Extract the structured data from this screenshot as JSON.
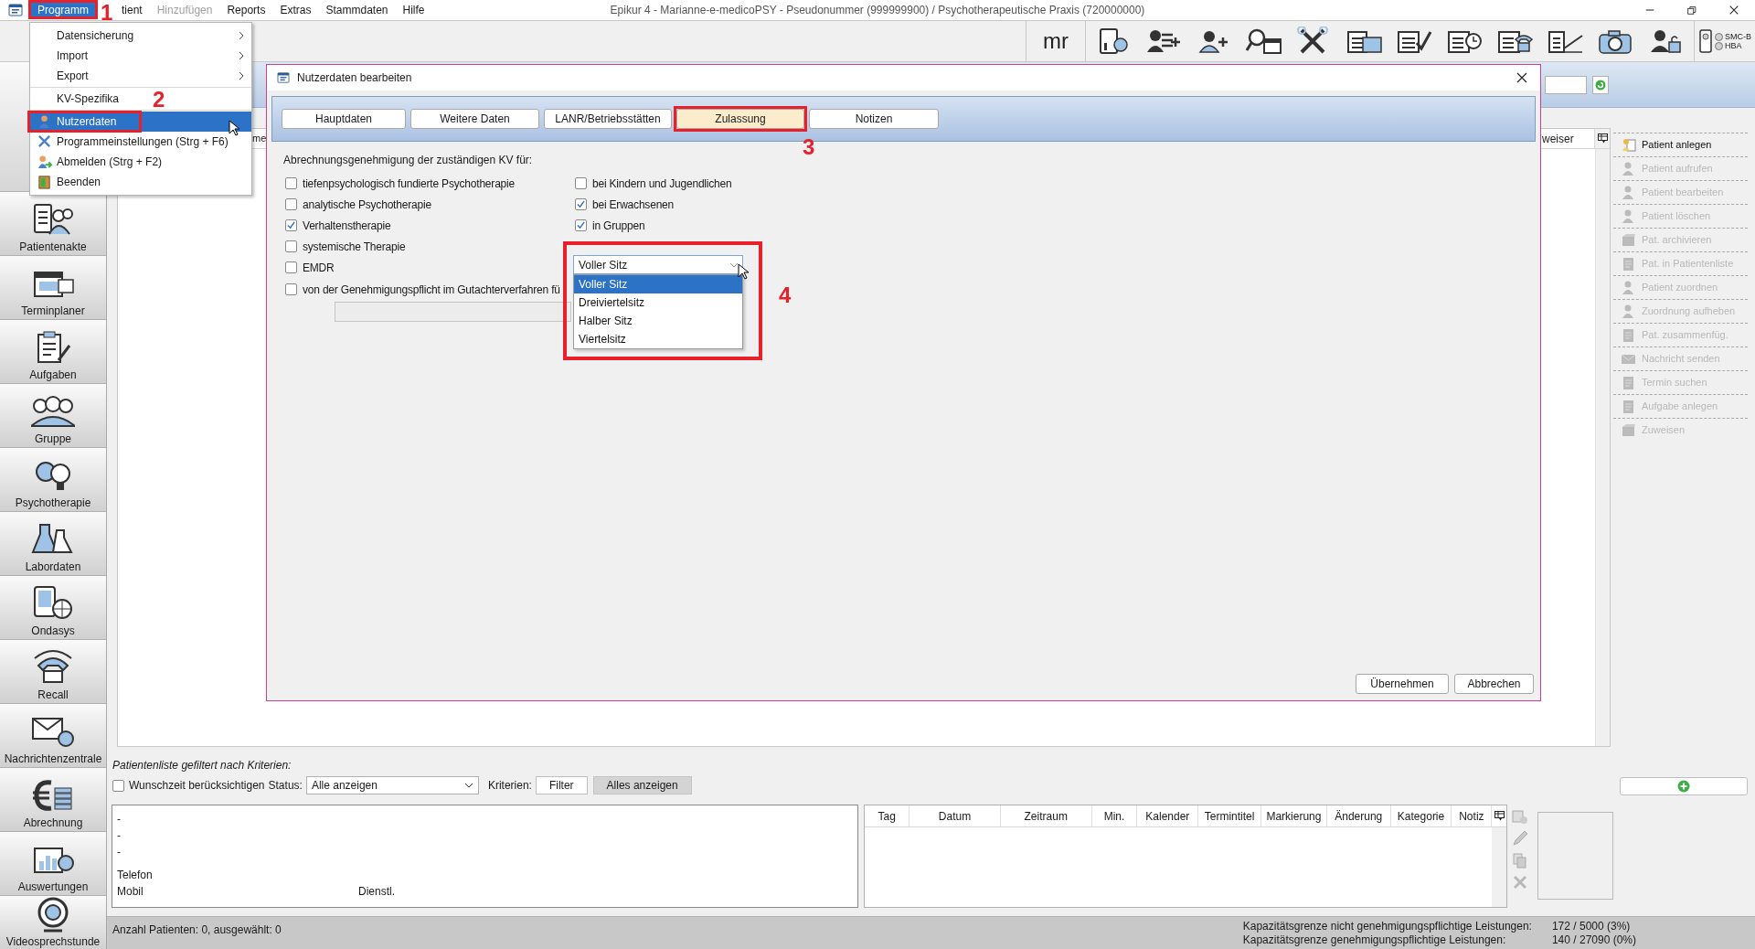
{
  "window": {
    "title": "Epikur 4 - Marianne-e-medicoPSY - Pseudonummer (999999900) / Psychotherapeutische Praxis (720000000)"
  },
  "menubar": [
    {
      "label": "Programm",
      "selected": true,
      "disabled": false,
      "marker": "1"
    },
    {
      "label": "tient",
      "selected": false,
      "disabled": false
    },
    {
      "label": "Hinzufügen",
      "selected": false,
      "disabled": true
    },
    {
      "label": "Reports",
      "selected": false,
      "disabled": false
    },
    {
      "label": "Extras",
      "selected": false,
      "disabled": false
    },
    {
      "label": "Stammdaten",
      "selected": false,
      "disabled": false
    },
    {
      "label": "Hilfe",
      "selected": false,
      "disabled": false
    }
  ],
  "program_menu": [
    {
      "label": "Datensicherung",
      "kind": "submenu",
      "selected": false
    },
    {
      "label": "Import",
      "kind": "submenu",
      "selected": false
    },
    {
      "label": "Export",
      "kind": "submenu",
      "selected": false
    },
    {
      "label": "KV-Spezifika",
      "kind": "plain",
      "selected": false,
      "separator_before": true
    },
    {
      "label": "Nutzerdaten",
      "kind": "command",
      "selected": true,
      "separator_before": true,
      "marker": "2"
    },
    {
      "label": "Programmeinstellungen (Strg + F6)",
      "kind": "command",
      "selected": false
    },
    {
      "label": "Abmelden (Strg + F2)",
      "kind": "command",
      "selected": false
    },
    {
      "label": "Beenden",
      "kind": "command",
      "selected": false
    }
  ],
  "toolbar": {
    "user": "mr",
    "card_status": [
      {
        "label": "SMC-B",
        "connected": false
      },
      {
        "label": "HBA",
        "connected": false
      }
    ]
  },
  "sidebar": {
    "items": [
      {
        "label": "Patientenakte"
      },
      {
        "label": "Terminplaner"
      },
      {
        "label": "Aufgaben"
      },
      {
        "label": "Gruppe"
      },
      {
        "label": "Psychotherapie"
      },
      {
        "label": "Labordaten"
      },
      {
        "label": "Ondasys"
      },
      {
        "label": "Recall"
      },
      {
        "label": "Nachrichtenzentrale"
      },
      {
        "label": "Abrechnung"
      },
      {
        "label": "Auswertungen"
      },
      {
        "label": "Videosprechstunde"
      }
    ]
  },
  "patient_table": {
    "columns": [
      "me",
      "weiser"
    ]
  },
  "dialog": {
    "title": "Nutzerdaten bearbeiten",
    "tabs": [
      {
        "label": "Hauptdaten",
        "selected": false
      },
      {
        "label": "Weitere Daten",
        "selected": false
      },
      {
        "label": "LANR/Betriebsstätten",
        "selected": false
      },
      {
        "label": "Zulassung",
        "selected": true,
        "marker": "3"
      },
      {
        "label": "Notizen",
        "selected": false
      }
    ],
    "section_label": "Abrechnungsgenehmigung der zuständigen KV für:",
    "left_options": [
      {
        "label": "tiefenpsychologisch fundierte Psychotherapie",
        "checked": false
      },
      {
        "label": "analytische Psychotherapie",
        "checked": false
      },
      {
        "label": "Verhaltenstherapie",
        "checked": true
      },
      {
        "label": "systemische Therapie",
        "checked": false
      },
      {
        "label": "EMDR",
        "checked": false
      },
      {
        "label": "von der Genehmigungspflicht im Gutachterverfahren fü",
        "checked": false
      }
    ],
    "right_options": [
      {
        "label": "bei Kindern und Jugendlichen",
        "checked": false
      },
      {
        "label": "bei Erwachsenen",
        "checked": true
      },
      {
        "label": "in Gruppen",
        "checked": true
      }
    ],
    "seat_dropdown": {
      "value": "Voller Sitz",
      "expanded": true,
      "marker": "4",
      "options": [
        {
          "label": "Voller Sitz",
          "selected": true
        },
        {
          "label": "Dreiviertelsitz",
          "selected": false
        },
        {
          "label": "Halber Sitz",
          "selected": false
        },
        {
          "label": "Viertelsitz",
          "selected": false
        }
      ]
    },
    "buttons": [
      {
        "label": "Übernehmen"
      },
      {
        "label": "Abbrechen"
      }
    ]
  },
  "actions": [
    {
      "label": "Patient anlegen",
      "disabled": false
    },
    {
      "label": "Patient aufrufen",
      "disabled": true
    },
    {
      "label": "Patient bearbeiten",
      "disabled": true
    },
    {
      "label": "Patient löschen",
      "disabled": true
    },
    {
      "label": "Pat. archivieren",
      "disabled": true
    },
    {
      "label": "Pat. in Patientenliste",
      "disabled": true
    },
    {
      "label": "Patient zuordnen",
      "disabled": true
    },
    {
      "label": "Zuordnung aufheben",
      "disabled": true
    },
    {
      "label": "Pat. zusammenfüg.",
      "disabled": true
    },
    {
      "label": "Nachricht senden",
      "disabled": true
    },
    {
      "label": "Termin suchen",
      "disabled": true
    },
    {
      "label": "Aufgabe anlegen",
      "disabled": true
    },
    {
      "label": "Zuweisen",
      "disabled": true
    }
  ],
  "filter": {
    "title": "Patientenliste gefiltert nach Kriterien:",
    "wish_time": {
      "label": "Wunschzeit berücksichtigen",
      "checked": false
    },
    "status_label": "Status:",
    "status_value": "Alle anzeigen",
    "criteria_label": "Kriterien:",
    "buttons": [
      {
        "label": "Filter",
        "kind": "plain"
      },
      {
        "label": "Alles anzeigen",
        "kind": "pressed"
      }
    ]
  },
  "patient_info": {
    "lines": [
      "-",
      "-",
      "-",
      "Telefon"
    ],
    "mobile_label": "Mobil",
    "work_label": "Dienstl."
  },
  "appointments": {
    "columns": [
      "Tag",
      "Datum",
      "Zeitraum",
      "Min.",
      "Kalender",
      "Termintitel",
      "Markierung",
      "Änderung",
      "Kategorie",
      "Notiz"
    ]
  },
  "status_bar": {
    "count": "Anzahl Patienten: 0, ausgewählt: 0",
    "capacity": [
      {
        "label": "Kapazitätsgrenze nicht genehmigungspflichtige Leistungen:",
        "value": "172 / 5000 (3%)"
      },
      {
        "label": "Kapazitätsgrenze genehmigungspflichtige Leistungen:",
        "value": "140 / 27090 (0%)"
      }
    ]
  }
}
